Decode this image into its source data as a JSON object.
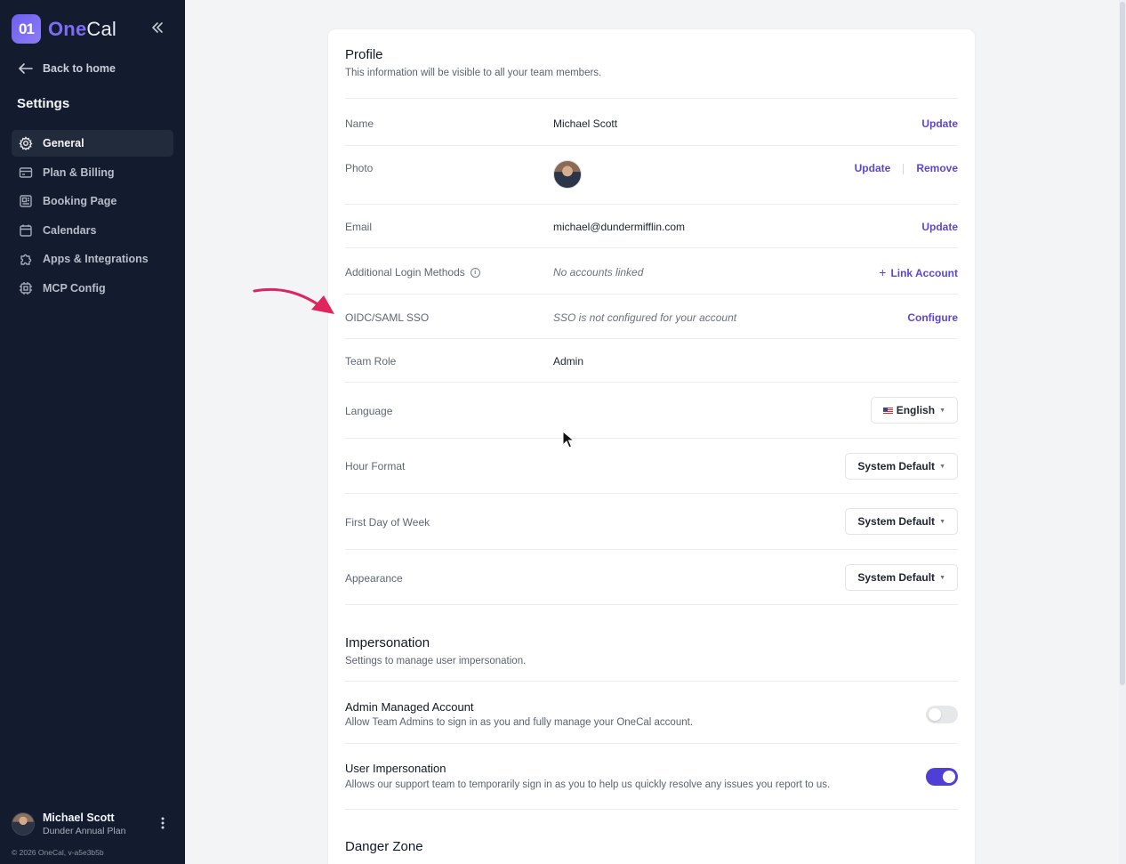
{
  "app": {
    "brand_prefix": "One",
    "brand_suffix": "Cal",
    "brand_mark": "01"
  },
  "sidebar": {
    "back_label": "Back to home",
    "title": "Settings",
    "items": [
      {
        "label": "General",
        "icon": "gear-icon",
        "active": true
      },
      {
        "label": "Plan & Billing",
        "icon": "credit-card-icon"
      },
      {
        "label": "Booking Page",
        "icon": "booking-page-icon"
      },
      {
        "label": "Calendars",
        "icon": "calendar-icon"
      },
      {
        "label": "Apps & Integrations",
        "icon": "puzzle-icon"
      },
      {
        "label": "MCP Config",
        "icon": "chip-icon"
      }
    ],
    "user": {
      "name": "Michael Scott",
      "plan": "Dunder Annual Plan"
    },
    "copyright": "© 2026 OneCal, v-a5e3b5b"
  },
  "profile": {
    "title": "Profile",
    "subtitle": "This information will be visible to all your team members.",
    "name": {
      "label": "Name",
      "value": "Michael Scott",
      "action": "Update"
    },
    "photo": {
      "label": "Photo",
      "update": "Update",
      "remove": "Remove"
    },
    "email": {
      "label": "Email",
      "value": "michael@dundermifflin.com",
      "action": "Update"
    },
    "login_methods": {
      "label": "Additional Login Methods",
      "value": "No accounts linked",
      "action": "Link Account"
    },
    "sso": {
      "label": "OIDC/SAML SSO",
      "value": "SSO is not configured for your account",
      "action": "Configure"
    },
    "team_role": {
      "label": "Team Role",
      "value": "Admin"
    },
    "language": {
      "label": "Language",
      "value": "English"
    },
    "hour_format": {
      "label": "Hour Format",
      "value": "System Default"
    },
    "first_day": {
      "label": "First Day of Week",
      "value": "System Default"
    },
    "appearance": {
      "label": "Appearance",
      "value": "System Default"
    }
  },
  "impersonation": {
    "title": "Impersonation",
    "subtitle": "Settings to manage user impersonation.",
    "admin_managed": {
      "title": "Admin Managed Account",
      "desc": "Allow Team Admins to sign in as you and fully manage your OneCal account.",
      "enabled": false
    },
    "user_impersonation": {
      "title": "User Impersonation",
      "desc": "Allows our support team to temporarily sign in as you to help us quickly resolve any issues you report to us.",
      "enabled": true
    }
  },
  "danger": {
    "title": "Danger Zone"
  },
  "colors": {
    "sidebar_bg": "#131c2e",
    "accent": "#5b47d6",
    "annotation_arrow": "#e0245e"
  }
}
